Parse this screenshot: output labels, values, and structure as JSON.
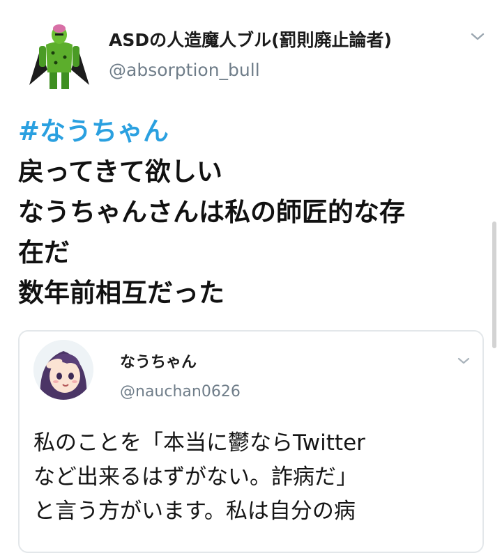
{
  "tweet": {
    "author": {
      "name": "ASDの人造魔人ブル(罰則廃止論者)",
      "handle": "@absorption_bull",
      "avatar_icon": "cell-character-avatar"
    },
    "body_lines": [
      "#なうちゃん",
      "戻ってきて欲しい",
      "なうちゃんさんは私の師匠的な存",
      "在だ",
      "数年前相互だった"
    ],
    "hashtag_color": "#2aa0e0",
    "menu_icon": "chevron-down-icon"
  },
  "quoted_tweet": {
    "author": {
      "name": "なうちゃん",
      "handle": "@nauchan0626",
      "avatar_icon": "anime-girl-avatar"
    },
    "body_lines": [
      "私のことを「本当に鬱ならTwitter",
      "など出来るはずがない。詐病だ」",
      "と言う方がいます。私は自分の病"
    ],
    "menu_icon": "chevron-down-icon"
  },
  "colors": {
    "handle": "#6f7d89",
    "accent": "#2aa0e0",
    "border": "#e3e7ea"
  }
}
